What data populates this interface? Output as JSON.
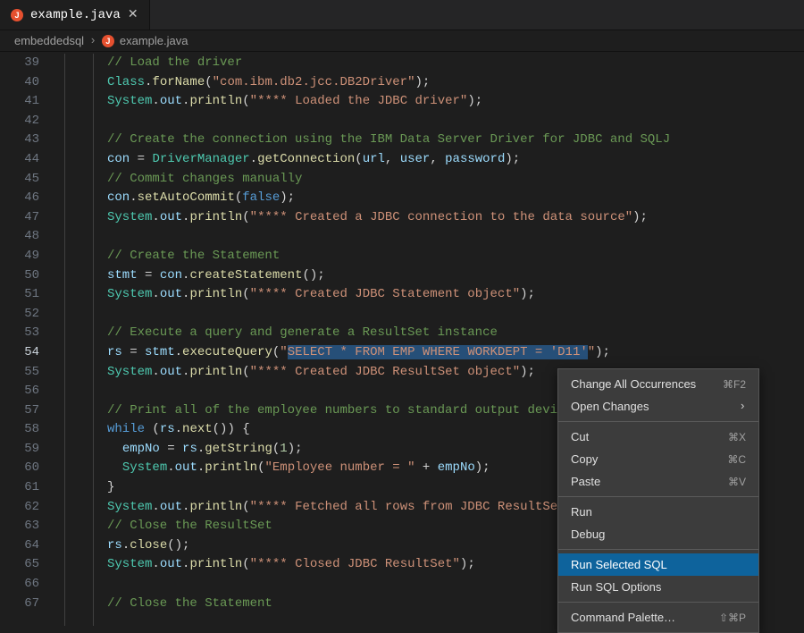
{
  "tab": {
    "filename": "example.java",
    "iconLetter": "J"
  },
  "breadcrumb": {
    "folder": "embeddedsql",
    "file": "example.java",
    "iconLetter": "J"
  },
  "gutter": {
    "start": 39,
    "end": 67,
    "active": 54
  },
  "code": {
    "lines": [
      [
        {
          "c": "c-cmt",
          "t": "// Load the driver"
        }
      ],
      [
        {
          "c": "c-cls",
          "t": "Class"
        },
        {
          "c": "c-pun",
          "t": "."
        },
        {
          "c": "c-fn",
          "t": "forName"
        },
        {
          "c": "c-pun",
          "t": "("
        },
        {
          "c": "c-str",
          "t": "\"com.ibm.db2.jcc.DB2Driver\""
        },
        {
          "c": "c-pun",
          "t": ");"
        }
      ],
      [
        {
          "c": "c-cls",
          "t": "System"
        },
        {
          "c": "c-pun",
          "t": "."
        },
        {
          "c": "c-id",
          "t": "out"
        },
        {
          "c": "c-pun",
          "t": "."
        },
        {
          "c": "c-fn",
          "t": "println"
        },
        {
          "c": "c-pun",
          "t": "("
        },
        {
          "c": "c-str",
          "t": "\"**** Loaded the JDBC driver\""
        },
        {
          "c": "c-pun",
          "t": ");"
        }
      ],
      [],
      [
        {
          "c": "c-cmt",
          "t": "// Create the connection using the IBM Data Server Driver for JDBC and SQLJ"
        }
      ],
      [
        {
          "c": "c-id",
          "t": "con"
        },
        {
          "c": "c-pun",
          "t": " = "
        },
        {
          "c": "c-cls",
          "t": "DriverManager"
        },
        {
          "c": "c-pun",
          "t": "."
        },
        {
          "c": "c-fn",
          "t": "getConnection"
        },
        {
          "c": "c-pun",
          "t": "("
        },
        {
          "c": "c-id",
          "t": "url"
        },
        {
          "c": "c-pun",
          "t": ", "
        },
        {
          "c": "c-id",
          "t": "user"
        },
        {
          "c": "c-pun",
          "t": ", "
        },
        {
          "c": "c-id",
          "t": "password"
        },
        {
          "c": "c-pun",
          "t": ");"
        }
      ],
      [
        {
          "c": "c-cmt",
          "t": "// Commit changes manually"
        }
      ],
      [
        {
          "c": "c-id",
          "t": "con"
        },
        {
          "c": "c-pun",
          "t": "."
        },
        {
          "c": "c-fn",
          "t": "setAutoCommit"
        },
        {
          "c": "c-pun",
          "t": "("
        },
        {
          "c": "c-kw",
          "t": "false"
        },
        {
          "c": "c-pun",
          "t": ");"
        }
      ],
      [
        {
          "c": "c-cls",
          "t": "System"
        },
        {
          "c": "c-pun",
          "t": "."
        },
        {
          "c": "c-id",
          "t": "out"
        },
        {
          "c": "c-pun",
          "t": "."
        },
        {
          "c": "c-fn",
          "t": "println"
        },
        {
          "c": "c-pun",
          "t": "("
        },
        {
          "c": "c-str",
          "t": "\"**** Created a JDBC connection to the data source\""
        },
        {
          "c": "c-pun",
          "t": ");"
        }
      ],
      [],
      [
        {
          "c": "c-cmt",
          "t": "// Create the Statement"
        }
      ],
      [
        {
          "c": "c-id",
          "t": "stmt"
        },
        {
          "c": "c-pun",
          "t": " = "
        },
        {
          "c": "c-id",
          "t": "con"
        },
        {
          "c": "c-pun",
          "t": "."
        },
        {
          "c": "c-fn",
          "t": "createStatement"
        },
        {
          "c": "c-pun",
          "t": "();"
        }
      ],
      [
        {
          "c": "c-cls",
          "t": "System"
        },
        {
          "c": "c-pun",
          "t": "."
        },
        {
          "c": "c-id",
          "t": "out"
        },
        {
          "c": "c-pun",
          "t": "."
        },
        {
          "c": "c-fn",
          "t": "println"
        },
        {
          "c": "c-pun",
          "t": "("
        },
        {
          "c": "c-str",
          "t": "\"**** Created JDBC Statement object\""
        },
        {
          "c": "c-pun",
          "t": ");"
        }
      ],
      [],
      [
        {
          "c": "c-cmt",
          "t": "// Execute a query and generate a ResultSet instance"
        }
      ],
      [
        {
          "c": "c-id",
          "t": "rs"
        },
        {
          "c": "c-pun",
          "t": " = "
        },
        {
          "c": "c-id",
          "t": "stmt"
        },
        {
          "c": "c-pun",
          "t": "."
        },
        {
          "c": "c-fn",
          "t": "executeQuery"
        },
        {
          "c": "c-pun",
          "t": "("
        },
        {
          "c": "c-str",
          "t": "\""
        },
        {
          "c": "c-str sel",
          "t": "SELECT * FROM EMP WHERE WORKDEPT = 'D11'"
        },
        {
          "c": "c-str",
          "t": "\""
        },
        {
          "c": "c-pun",
          "t": ");"
        }
      ],
      [
        {
          "c": "c-cls",
          "t": "System"
        },
        {
          "c": "c-pun",
          "t": "."
        },
        {
          "c": "c-id",
          "t": "out"
        },
        {
          "c": "c-pun",
          "t": "."
        },
        {
          "c": "c-fn",
          "t": "println"
        },
        {
          "c": "c-pun",
          "t": "("
        },
        {
          "c": "c-str",
          "t": "\"**** Created JDBC ResultSet object\""
        },
        {
          "c": "c-pun",
          "t": ");"
        }
      ],
      [],
      [
        {
          "c": "c-cmt",
          "t": "// Print all of the employee numbers to standard output device"
        }
      ],
      [
        {
          "c": "c-kw",
          "t": "while"
        },
        {
          "c": "c-pun",
          "t": " ("
        },
        {
          "c": "c-id",
          "t": "rs"
        },
        {
          "c": "c-pun",
          "t": "."
        },
        {
          "c": "c-fn",
          "t": "next"
        },
        {
          "c": "c-pun",
          "t": "()) {"
        }
      ],
      [
        {
          "c": "c-pun",
          "t": "  "
        },
        {
          "c": "c-id",
          "t": "empNo"
        },
        {
          "c": "c-pun",
          "t": " = "
        },
        {
          "c": "c-id",
          "t": "rs"
        },
        {
          "c": "c-pun",
          "t": "."
        },
        {
          "c": "c-fn",
          "t": "getString"
        },
        {
          "c": "c-pun",
          "t": "("
        },
        {
          "c": "c-num",
          "t": "1"
        },
        {
          "c": "c-pun",
          "t": ");"
        }
      ],
      [
        {
          "c": "c-pun",
          "t": "  "
        },
        {
          "c": "c-cls",
          "t": "System"
        },
        {
          "c": "c-pun",
          "t": "."
        },
        {
          "c": "c-id",
          "t": "out"
        },
        {
          "c": "c-pun",
          "t": "."
        },
        {
          "c": "c-fn",
          "t": "println"
        },
        {
          "c": "c-pun",
          "t": "("
        },
        {
          "c": "c-str",
          "t": "\"Employee number = \""
        },
        {
          "c": "c-pun",
          "t": " + "
        },
        {
          "c": "c-id",
          "t": "empNo"
        },
        {
          "c": "c-pun",
          "t": ");"
        }
      ],
      [
        {
          "c": "c-pun",
          "t": "}"
        }
      ],
      [
        {
          "c": "c-cls",
          "t": "System"
        },
        {
          "c": "c-pun",
          "t": "."
        },
        {
          "c": "c-id",
          "t": "out"
        },
        {
          "c": "c-pun",
          "t": "."
        },
        {
          "c": "c-fn",
          "t": "println"
        },
        {
          "c": "c-pun",
          "t": "("
        },
        {
          "c": "c-str",
          "t": "\"**** Fetched all rows from JDBC ResultSet\""
        },
        {
          "c": "c-pun",
          "t": ");"
        }
      ],
      [
        {
          "c": "c-cmt",
          "t": "// Close the ResultSet"
        }
      ],
      [
        {
          "c": "c-id",
          "t": "rs"
        },
        {
          "c": "c-pun",
          "t": "."
        },
        {
          "c": "c-fn",
          "t": "close"
        },
        {
          "c": "c-pun",
          "t": "();"
        }
      ],
      [
        {
          "c": "c-cls",
          "t": "System"
        },
        {
          "c": "c-pun",
          "t": "."
        },
        {
          "c": "c-id",
          "t": "out"
        },
        {
          "c": "c-pun",
          "t": "."
        },
        {
          "c": "c-fn",
          "t": "println"
        },
        {
          "c": "c-pun",
          "t": "("
        },
        {
          "c": "c-str",
          "t": "\"**** Closed JDBC ResultSet\""
        },
        {
          "c": "c-pun",
          "t": ");"
        }
      ],
      [],
      [
        {
          "c": "c-cmt",
          "t": "// Close the Statement"
        }
      ]
    ]
  },
  "menu": {
    "items": [
      {
        "kind": "item",
        "label": "Change All Occurrences",
        "shortcut": "⌘F2"
      },
      {
        "kind": "item",
        "label": "Open Changes",
        "sub": true
      },
      {
        "kind": "sep"
      },
      {
        "kind": "item",
        "label": "Cut",
        "shortcut": "⌘X"
      },
      {
        "kind": "item",
        "label": "Copy",
        "shortcut": "⌘C"
      },
      {
        "kind": "item",
        "label": "Paste",
        "shortcut": "⌘V"
      },
      {
        "kind": "sep"
      },
      {
        "kind": "item",
        "label": "Run"
      },
      {
        "kind": "item",
        "label": "Debug"
      },
      {
        "kind": "sep"
      },
      {
        "kind": "item",
        "label": "Run Selected SQL",
        "hl": true
      },
      {
        "kind": "item",
        "label": "Run SQL Options"
      },
      {
        "kind": "sep"
      },
      {
        "kind": "item",
        "label": "Command Palette…",
        "shortcut": "⇧⌘P"
      }
    ]
  }
}
